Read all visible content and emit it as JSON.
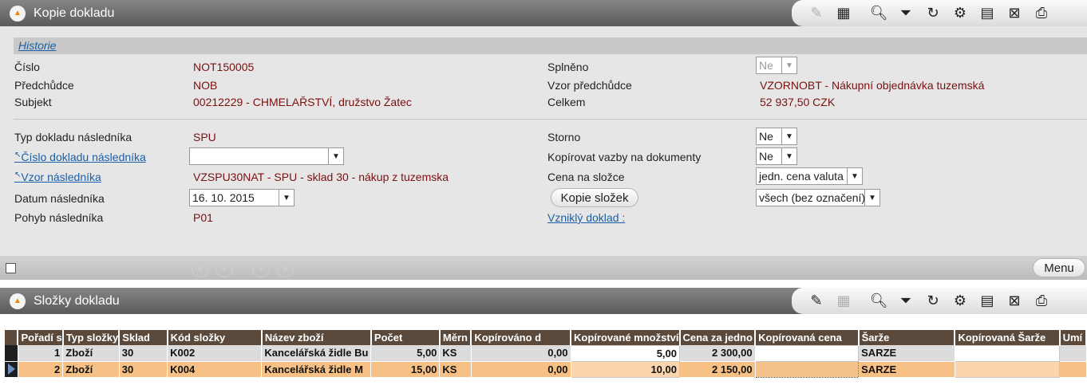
{
  "top_panel": {
    "title": "Kopie dokladu",
    "history_link": "Historie",
    "fields": {
      "cislo_label": "Číslo",
      "cislo_value": "NOT150005",
      "predchudce_label": "Předchůdce",
      "predchudce_value": "NOB",
      "subjekt_label": "Subjekt",
      "subjekt_value": "00212229 - CHMELAŘSTVÍ, družstvo Žatec",
      "splneno_label": "Splněno",
      "splneno_value": "Ne",
      "vzor_predchudce_label": "Vzor předchůdce",
      "vzor_predchudce_value": "VZORNOBT  -  Nákupní objednávka tuzemská",
      "celkem_label": "Celkem",
      "celkem_value": "52 937,50  CZK",
      "typ_label": "Typ dokladu následníka",
      "typ_value": "SPU",
      "cislo_nasl_label": "Číslo dokladu následníka",
      "cislo_nasl_value": "",
      "vzor_nasl_label": "Vzor následníka",
      "vzor_nasl_value": "VZSPU30NAT  -  SPU - sklad 30 - nákup z tuzemska",
      "datum_label": "Datum následníka",
      "datum_value": "16. 10. 2015",
      "pohyb_label": "Pohyb následníka",
      "pohyb_value": "P01",
      "storno_label": "Storno",
      "storno_value": "Ne",
      "kopirovat_label": "Kopírovat vazby na dokumenty",
      "kopirovat_value": "Ne",
      "cena_label": "Cena na složce",
      "cena_value": "jedn. cena valuta",
      "kopie_slozek_button": "Kopie složek",
      "kopie_slozek_value": "všech (bez označení)",
      "vznikly_doklad_link": "Vzniklý doklad :"
    },
    "menu_button": "Menu"
  },
  "bottom_panel": {
    "title": "Složky dokladu",
    "columns": [
      "Pořadí s",
      "Typ složky",
      "Sklad",
      "Kód složky",
      "Název zboží",
      "Počet",
      "Měrn",
      "Kopírováno d",
      "Kopírované množství",
      "Cena za jedno",
      "Kopírovaná cena",
      "Šarže",
      "Kopírovaná Šarže",
      "Umí"
    ],
    "rows": [
      [
        "1",
        "Zboží",
        "30",
        "K002",
        "Kancelářská židle Bu",
        "5,00",
        "KS",
        "0,00",
        "5,00",
        "2 300,00",
        "",
        "SARZE",
        "",
        ""
      ],
      [
        "2",
        "Zboží",
        "30",
        "K004",
        "Kancelářská židle M",
        "15,00",
        "KS",
        "0,00",
        "10,00",
        "2 150,00",
        "",
        "SARZE",
        "",
        ""
      ]
    ]
  },
  "colors": {
    "titlebar": "#6e6e6e",
    "value_text": "#7a1010",
    "link": "#1a5fa8",
    "header": "#5b4a3c",
    "selected_row": "#f7c186"
  }
}
